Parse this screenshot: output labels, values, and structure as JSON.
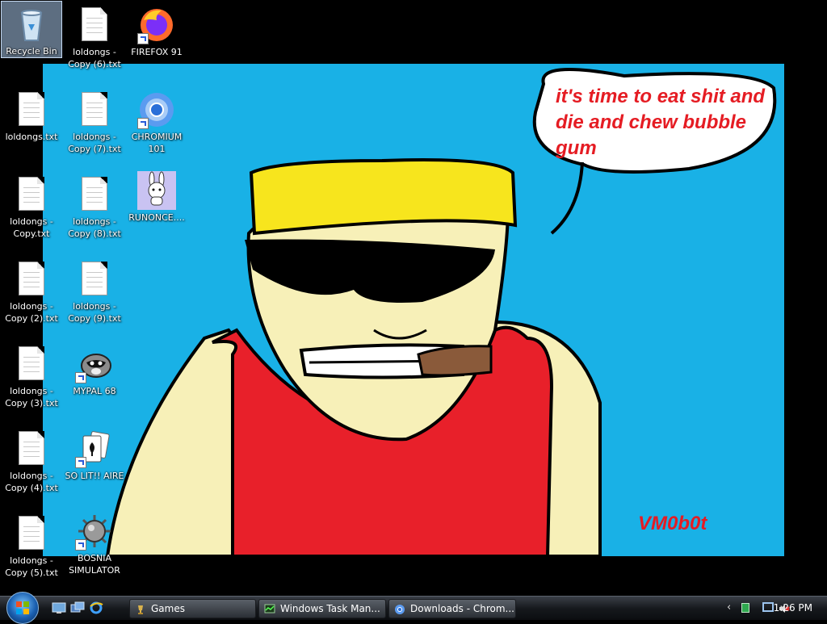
{
  "desktop": {
    "icons": [
      {
        "id": "recycle",
        "label": "Recycle Bin",
        "type": "recycle",
        "selected": true
      },
      {
        "id": "c6",
        "label": "loldongs - Copy (6).txt",
        "type": "txt"
      },
      {
        "id": "ff",
        "label": "FIREFOX 91",
        "type": "firefox"
      },
      {
        "id": "l0",
        "label": "loldongs.txt",
        "type": "txt"
      },
      {
        "id": "c7",
        "label": "loldongs - Copy (7).txt",
        "type": "txt"
      },
      {
        "id": "chr",
        "label": "CHROMIUM 101",
        "type": "chromium"
      },
      {
        "id": "c1",
        "label": "loldongs - Copy.txt",
        "type": "txt"
      },
      {
        "id": "c8",
        "label": "loldongs - Copy (8).txt",
        "type": "txt"
      },
      {
        "id": "run",
        "label": "RUNONCE....",
        "type": "bunny"
      },
      {
        "id": "c2",
        "label": "loldongs - Copy (2).txt",
        "type": "txt"
      },
      {
        "id": "c9",
        "label": "loldongs - Copy (9).txt",
        "type": "txt"
      },
      {
        "id": "c3",
        "label": "loldongs - Copy (3).txt",
        "type": "txt"
      },
      {
        "id": "mp",
        "label": "MYPAL 68",
        "type": "mypal"
      },
      {
        "id": "c4",
        "label": "loldongs - Copy (4).txt",
        "type": "txt"
      },
      {
        "id": "sol",
        "label": "SO LIT!! AIRE",
        "type": "cards"
      },
      {
        "id": "c5",
        "label": "loldongs - Copy (5).txt",
        "type": "txt"
      },
      {
        "id": "bos",
        "label": "BOSNIA SIMULATOR",
        "type": "mace"
      }
    ]
  },
  "wallpaper": {
    "speech_text": "it's time to eat shit and die and chew bubble gum",
    "signature": "VM0b0t",
    "sky_color": "#19b1e6",
    "text_color": "#e51c23"
  },
  "taskbar": {
    "start_icon": "windows-flag-icon",
    "quick_launch": [
      "show-desktop-icon",
      "switch-windows-icon",
      "internet-explorer-icon"
    ],
    "tasks": [
      {
        "label": "Games",
        "icon": "games-icon"
      },
      {
        "label": "Windows Task Man...",
        "icon": "task-manager-icon"
      },
      {
        "label": "Downloads - Chrom...",
        "icon": "chromium-icon"
      }
    ],
    "clock": "1:26 PM"
  }
}
